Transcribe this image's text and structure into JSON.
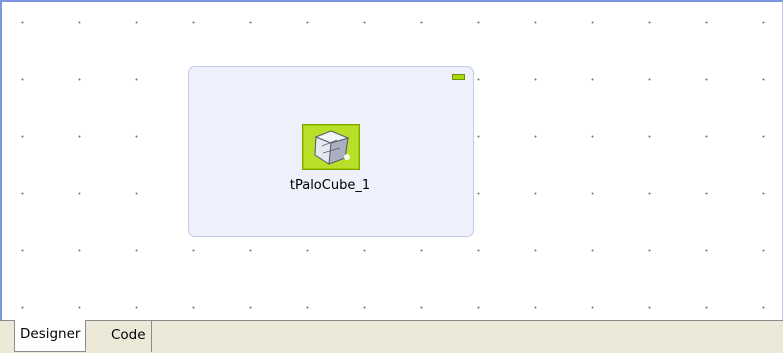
{
  "canvas": {
    "component": {
      "label": "tPaloCube_1",
      "icon": "palo-cube-icon"
    },
    "subjob": {
      "collapse_icon": "collapse-icon",
      "color": "#eef0fb"
    }
  },
  "tabs": [
    {
      "label": "Designer",
      "active": true
    },
    {
      "label": "Code",
      "active": false
    }
  ],
  "colors": {
    "accent": "#7a96df",
    "component_bg": "#a8d810"
  }
}
